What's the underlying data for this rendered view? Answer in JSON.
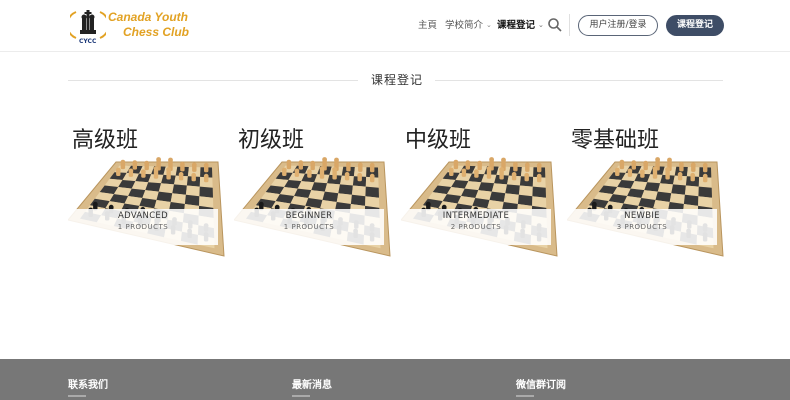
{
  "logo": {
    "line1": "Canada Youth",
    "line2": "Chess Club",
    "abbr": "CYCC"
  },
  "nav": {
    "items": [
      {
        "label": "主頁"
      },
      {
        "label": "学校简介"
      },
      {
        "label": "课程登记"
      }
    ],
    "register_label": "用户注册/登录",
    "course_button_label": "课程登记"
  },
  "section": {
    "title": "课程登记"
  },
  "categories": [
    {
      "title": "高级班",
      "name": "ADVANCED",
      "count": "1 PRODUCTS"
    },
    {
      "title": "初级班",
      "name": "BEGINNER",
      "count": "1 PRODUCTS"
    },
    {
      "title": "中级班",
      "name": "INTERMEDIATE",
      "count": "2 PRODUCTS"
    },
    {
      "title": "零基础班",
      "name": "NEWBIE",
      "count": "3 PRODUCTS"
    }
  ],
  "footer": {
    "contact": "联系我们",
    "news": "最新消息",
    "wechat": "微信群订阅"
  },
  "colors": {
    "brand_gold": "#e2a224",
    "button_dark": "#3e4d66",
    "footer_bg": "#777777"
  }
}
